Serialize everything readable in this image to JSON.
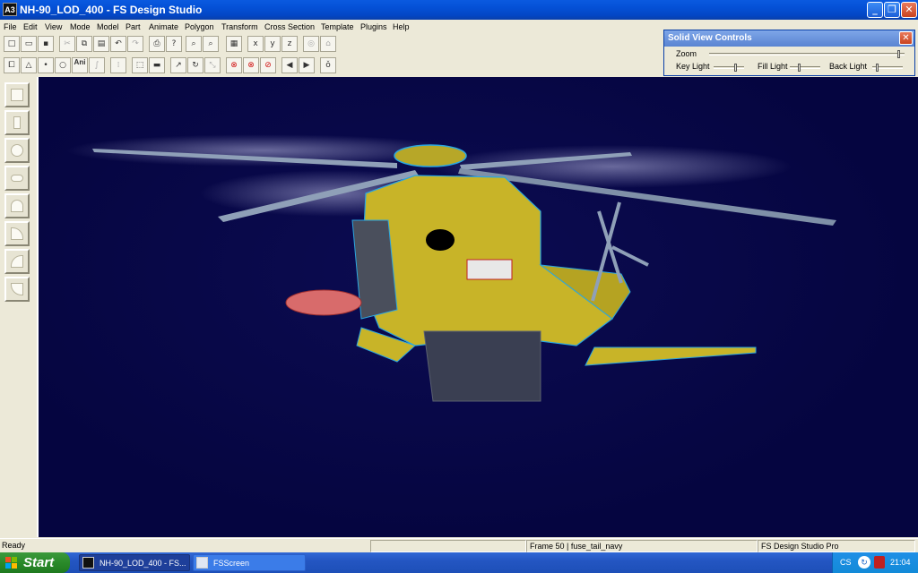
{
  "window": {
    "title": "NH-90_LOD_400 - FS Design Studio",
    "app_icon": "A3",
    "minimize": "_",
    "maximize": "❐",
    "close": "✕"
  },
  "menu": [
    "File",
    "Edit",
    "View",
    "Mode",
    "Model",
    "Part",
    "Animate",
    "Polygon",
    "Transform",
    "Cross Section",
    "Template",
    "Plugins",
    "Help"
  ],
  "toolbar_row1": [
    "new-icon",
    "open-icon",
    "save-icon",
    "cut-icon",
    "copy-icon",
    "paste-icon",
    "undo-icon",
    "redo-icon",
    "print-icon",
    "help-icon",
    "zoom-in-icon",
    "zoom-out-icon",
    "grid-icon",
    "x-axis-icon",
    "y-axis-icon",
    "z-axis-icon",
    "view-icon",
    "home-icon"
  ],
  "toolbar_row2": {
    "ani_label": "Ani"
  },
  "solid_view_controls": {
    "title": "Solid View Controls",
    "zoom": "Zoom",
    "key_light": "Key Light",
    "fill_light": "Fill Light",
    "back_light": "Back Light"
  },
  "status": {
    "left": "Ready",
    "middle": "Frame 50 | fuse_tail_navy",
    "right": "FS Design Studio Pro"
  },
  "taskbar": {
    "start": "Start",
    "tasks": [
      "NH-90_LOD_400 - FS...",
      "FSScreen"
    ],
    "lang": "CS",
    "clock": "21:04"
  },
  "colors": {
    "viewport_bg": "#050540",
    "model_fill": "#c8b428",
    "model_lines": "#2aa6e0",
    "titlebar": "#0450d6"
  }
}
